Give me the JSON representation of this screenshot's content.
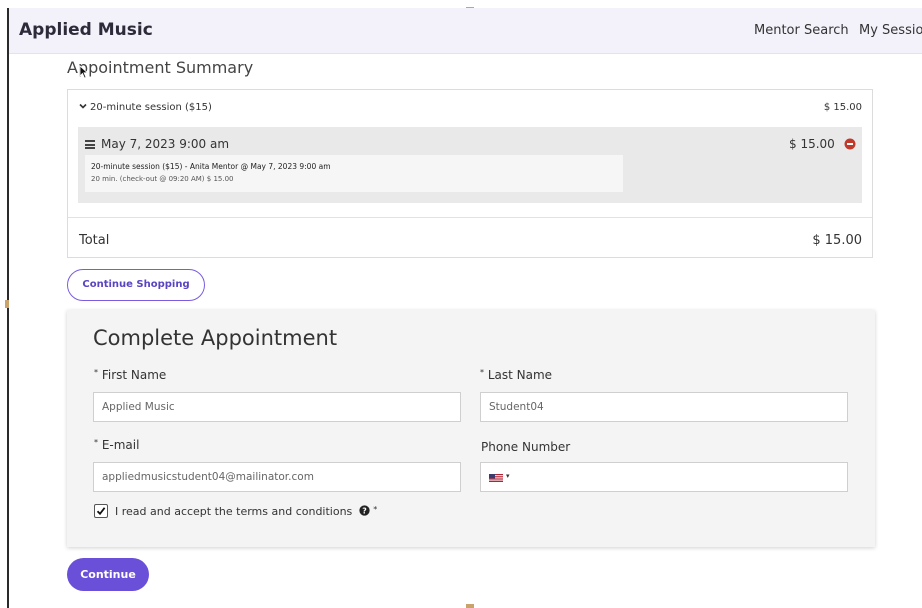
{
  "header": {
    "brand": "Applied Music",
    "nav": {
      "mentor_search": "Mentor Search",
      "my_sessions": "My Sessions"
    }
  },
  "summary": {
    "title": "Appointment Summary",
    "group": {
      "label": "20-minute session ($15)",
      "price": "$ 15.00"
    },
    "item": {
      "date": "May 7, 2023 9:00 am",
      "price": "$ 15.00",
      "detail_line1": "20-minute session ($15) - Anita Mentor @ May 7, 2023 9:00 am",
      "detail_line2": "20 min. (check-out @ 09:20 AM)   $ 15.00"
    },
    "total_label": "Total",
    "total_value": "$ 15.00"
  },
  "actions": {
    "continue_shopping": "Continue Shopping",
    "continue": "Continue"
  },
  "form": {
    "title": "Complete Appointment",
    "required_marker": "*",
    "first_name": {
      "label": "First Name",
      "value": "Applied Music"
    },
    "last_name": {
      "label": "Last Name",
      "value": "Student04"
    },
    "email": {
      "label": "E-mail",
      "value": "appliedmusicstudent04@mailinator.com"
    },
    "phone": {
      "label": "Phone Number",
      "value": "",
      "country": "US"
    },
    "terms": {
      "label": "I read and accept the terms and conditions",
      "checked": true
    }
  },
  "colors": {
    "accent": "#6a4fd8",
    "nav_bg": "#f3f2fb",
    "remove": "#c0392b",
    "panel_bg": "#f4f4f4"
  },
  "icons": [
    "chevron-down-icon",
    "hamburger-icon",
    "remove-icon",
    "check-icon",
    "help-icon",
    "us-flag-icon",
    "cursor-icon"
  ]
}
